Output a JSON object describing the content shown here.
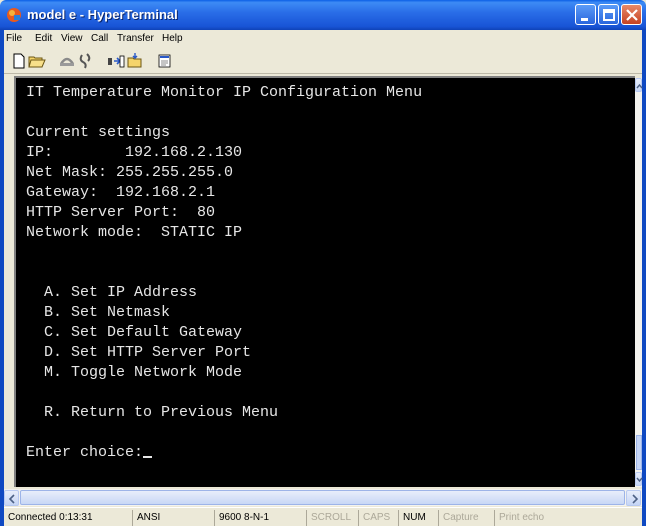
{
  "window": {
    "title": "model e - HyperTerminal"
  },
  "menubar": {
    "items": [
      "File",
      "Edit",
      "View",
      "Call",
      "Transfer",
      "Help"
    ]
  },
  "toolbar": {
    "buttons": [
      "new-icon",
      "open-icon",
      "connect-icon",
      "disconnect-icon",
      "send-icon",
      "receive-icon",
      "properties-icon"
    ]
  },
  "terminal": {
    "lines": [
      "IT Temperature Monitor IP Configuration Menu",
      "",
      "Current settings",
      "IP:        192.168.2.130",
      "Net Mask: 255.255.255.0",
      "Gateway:  192.168.2.1",
      "HTTP Server Port:  80",
      "Network mode:  STATIC IP",
      "",
      "",
      "",
      "  A. Set IP Address",
      "  B. Set Netmask",
      "  C. Set Default Gateway",
      "  D. Set HTTP Server Port",
      "  M. Toggle Network Mode",
      "",
      "  R. Return to Previous Menu",
      "",
      "",
      "Enter choice:"
    ]
  },
  "statusbar": {
    "connected": "Connected 0:13:31",
    "emulation": "ANSI",
    "settings": "9600 8-N-1",
    "scroll": "SCROLL",
    "caps": "CAPS",
    "num": "NUM",
    "capture": "Capture",
    "print_echo": "Print echo"
  },
  "colors": {
    "terminal_bg": "#000000",
    "terminal_fg": "#E6E6E6",
    "titlebar": "#1854D6"
  }
}
